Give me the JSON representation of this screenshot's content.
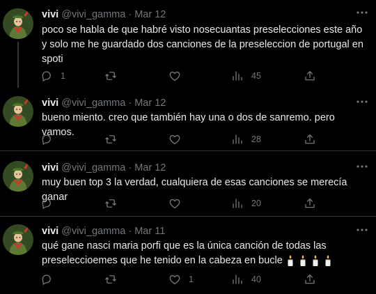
{
  "tweets": [
    {
      "name": "vivi",
      "handle": "@vivi_gamma",
      "separator": "·",
      "date": "Mar 12",
      "text": "poco se habla de que habré visto nosecuantas preselecciones este año y solo me he guardado dos canciones de la preseleccion de portugal en spoti",
      "replies": "1",
      "retweets": "",
      "likes": "",
      "views": "45"
    },
    {
      "name": "vivi",
      "handle": "@vivi_gamma",
      "separator": "·",
      "date": "Mar 12",
      "text": "bueno miento. creo que también hay una o dos de sanremo. pero vamos.",
      "replies": "",
      "retweets": "",
      "likes": "",
      "views": "28"
    },
    {
      "name": "vivi",
      "handle": "@vivi_gamma",
      "separator": "·",
      "date": "Mar 12",
      "text": "muy buen top 3 la verdad, cualquiera de esas canciones se merecía ganar",
      "replies": "",
      "retweets": "",
      "likes": "",
      "views": "20"
    },
    {
      "name": "vivi",
      "handle": "@vivi_gamma",
      "separator": "·",
      "date": "Mar 11",
      "text": "qué gane nasci maria porfi que es la única canción de todas las preseleccioemes que he tenido en la cabeza en bucle",
      "emoji": "candle x4",
      "replies": "",
      "retweets": "",
      "likes": "1",
      "views": "40"
    }
  ],
  "icons": {
    "more": "more-icon",
    "reply": "reply-icon",
    "retweet": "retweet-icon",
    "like": "heart-icon",
    "views": "views-icon",
    "share": "share-icon"
  },
  "colors": {
    "background": "#000000",
    "text": "#e7e9ea",
    "muted": "#71767b",
    "divider": "#2f3336"
  }
}
